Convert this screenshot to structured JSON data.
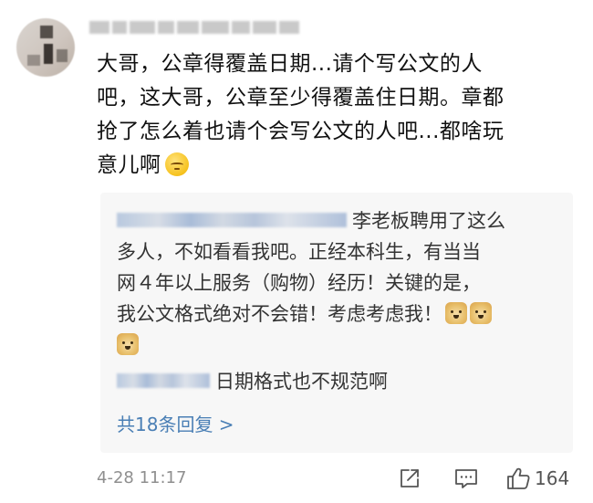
{
  "comment": {
    "text": "大哥，公章得覆盖日期...请个写公文的人\n吧，这大哥，公章至少得覆盖住日期。章都\n抢了怎么着也请个会写公文的人吧...都啥玩\n意儿啊",
    "emoji_icon": "sleepy-face-icon"
  },
  "replies": [
    {
      "text_line1": "李老板聘用了这么",
      "text_rest": "多人，不如看看我吧。正经本科生，有当当\n网４年以上服务（购物）经历！关键的是，\n我公文格式绝对不会错！考虑考虑我！",
      "emoji_icon": "doge-icon"
    },
    {
      "text": "日期格式也不规范啊"
    }
  ],
  "more_replies": "共18条回复 >",
  "footer": {
    "timestamp": "4-28 11:17",
    "like_count": "164",
    "share_icon": "share-icon",
    "comment_icon": "comment-icon",
    "like_icon": "thumbs-up-icon"
  },
  "colors": {
    "link": "#4a7fb5",
    "meta": "#8f8f8f",
    "reply_bg": "#f7f7f7"
  }
}
